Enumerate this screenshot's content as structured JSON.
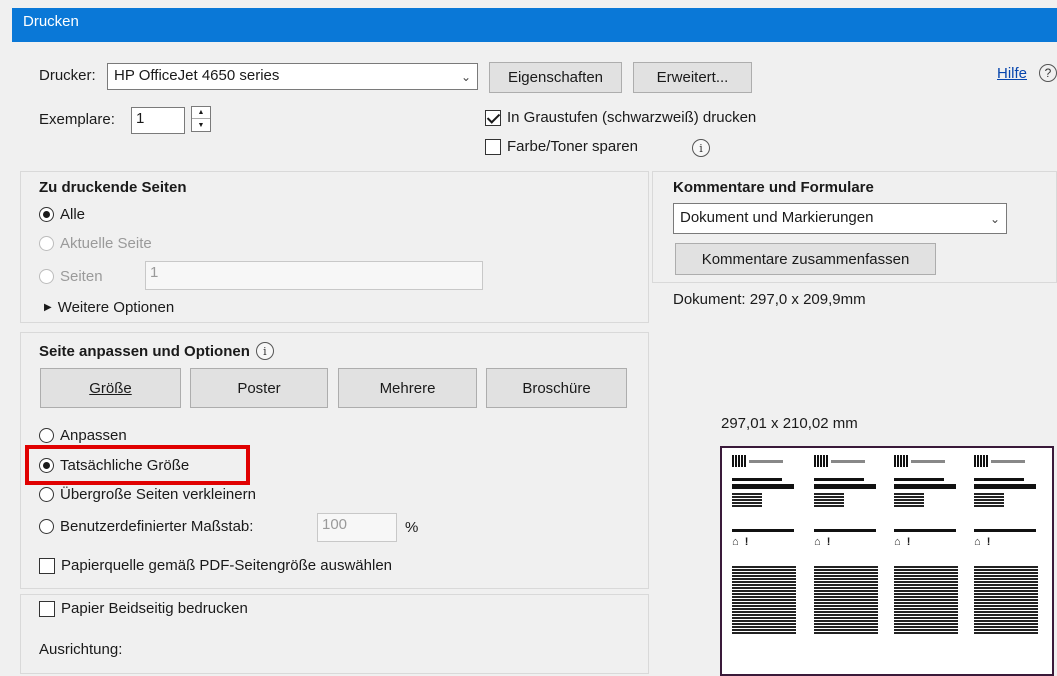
{
  "window": {
    "title": "Drucken"
  },
  "printer": {
    "label": "Drucker:",
    "selected": "HP OfficeJet 4650 series",
    "properties_button": "Eigenschaften",
    "advanced_button": "Erweitert...",
    "help_link": "Hilfe",
    "help_icon": "question-circle-icon"
  },
  "copies": {
    "label": "Exemplare:",
    "value": "1"
  },
  "options": {
    "grayscale": {
      "label": "In Graustufen (schwarzweiß) drucken",
      "checked": true
    },
    "save_toner": {
      "label": "Farbe/Toner sparen",
      "checked": false
    }
  },
  "pages": {
    "heading": "Zu druckende Seiten",
    "all": "Alle",
    "current": "Aktuelle Seite",
    "pages": "Seiten",
    "pages_value": "1",
    "more_options": "Weitere Optionen"
  },
  "comments": {
    "heading": "Kommentare und Formulare",
    "selected": "Dokument und Markierungen",
    "summarize_button": "Kommentare zusammenfassen"
  },
  "document": {
    "size_label": "Dokument: 297,0 x 209,9mm",
    "preview_size": "297,01 x 210,02 mm"
  },
  "sizing": {
    "heading": "Seite anpassen und Optionen",
    "tabs": [
      "Größe",
      "Poster",
      "Mehrere",
      "Broschüre"
    ],
    "fit": "Anpassen",
    "actual": "Tatsächliche Größe",
    "shrink": "Übergroße Seiten verkleinern",
    "custom": "Benutzerdefinierter Maßstab:",
    "custom_value": "100",
    "percent": "%",
    "paper_source": "Papierquelle gemäß PDF-Seitengröße auswählen"
  },
  "duplex": {
    "label": "Papier Beidseitig bedrucken"
  },
  "orientation": {
    "label": "Ausrichtung:"
  },
  "colors": {
    "titlebar": "#0a78d7",
    "highlight": "#e00000",
    "preview_border": "#3a1a3a"
  }
}
